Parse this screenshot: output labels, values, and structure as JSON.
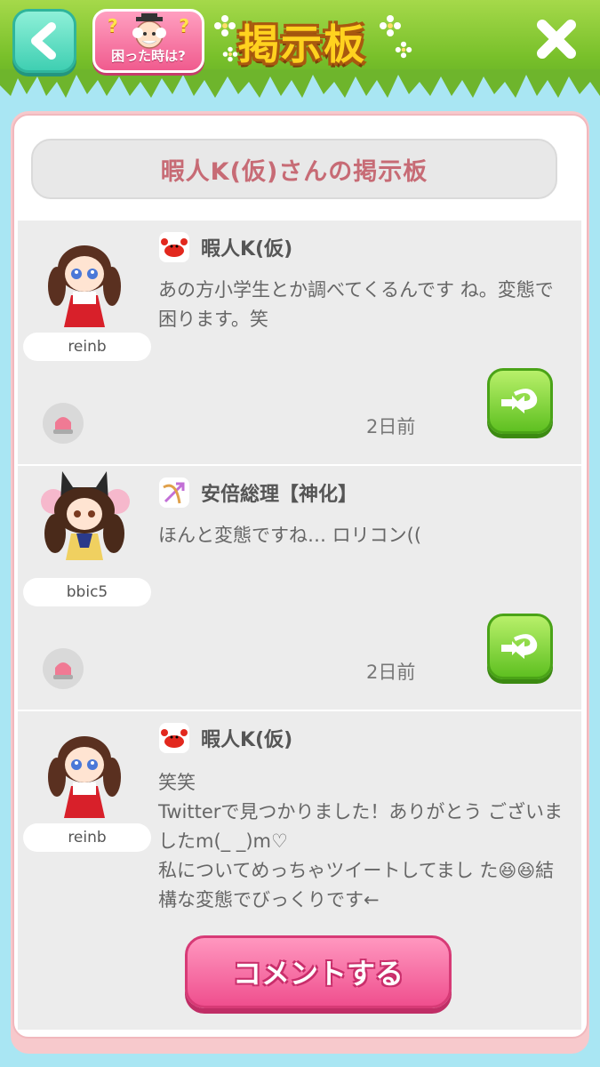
{
  "header": {
    "help_label": "困った時は?",
    "help_q": "?",
    "title": "掲示板"
  },
  "board": {
    "title": "暇人K(仮)さんの掲示板"
  },
  "posts": [
    {
      "username": "reinb",
      "name": "暇人K(仮)",
      "zodiac_icon": "crab-icon",
      "body": "あの方小学生とか調べてくるんです ね。変態で困ります。笑",
      "time": "2日前"
    },
    {
      "username": "bbic5",
      "name": "安倍総理【神化】",
      "zodiac_icon": "archer-bow-icon",
      "body": "ほんと変態ですね… ロリコン((",
      "time": "2日前"
    },
    {
      "username": "reinb",
      "name": "暇人K(仮)",
      "zodiac_icon": "crab-icon",
      "body_line1": "笑笑",
      "body_line2": "Twitterで見つかりました！ありがとう ございましたm(_ _)m♡",
      "body_line3a": "私についてめっちゃツイートしてまし た",
      "emoji": "😆😆",
      "body_line3b": "結構な変態でびっくりです←"
    }
  ],
  "comment_button_label": "コメントする",
  "colors": {
    "accent_pink": "#ef4f8e",
    "title_text": "#c76b75",
    "reply_green": "#5fc021",
    "back_teal": "#3fcfb2"
  }
}
